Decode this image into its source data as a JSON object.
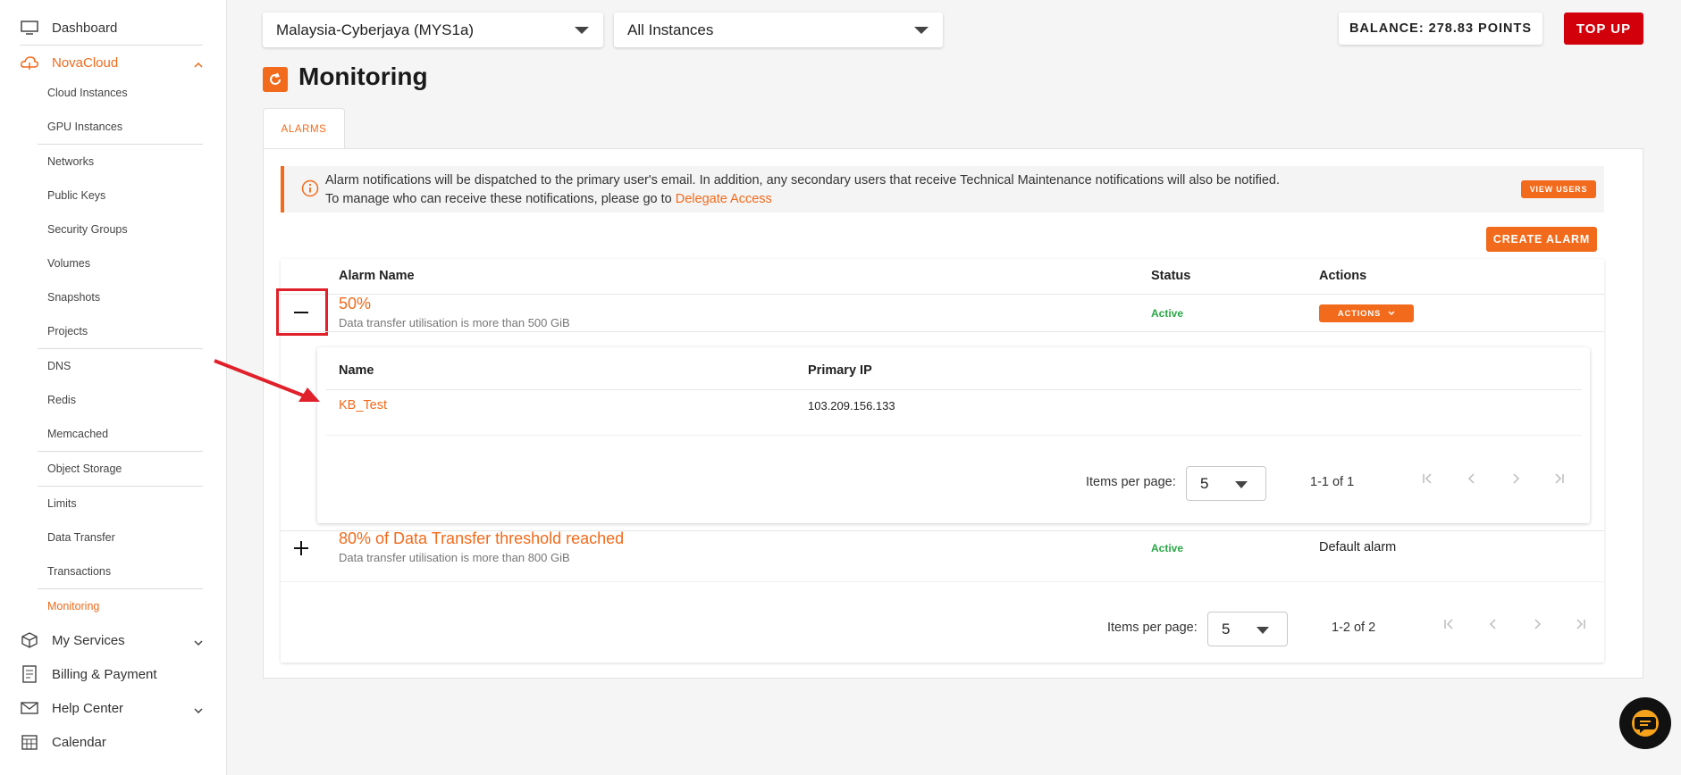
{
  "sidebar": {
    "dashboard": "Dashboard",
    "novacloud": "NovaCloud",
    "sub_items": [
      "Cloud Instances",
      "GPU Instances",
      "Networks",
      "Public Keys",
      "Security Groups",
      "Volumes",
      "Snapshots",
      "Projects",
      "DNS",
      "Redis",
      "Memcached",
      "Object Storage",
      "Limits",
      "Data Transfer",
      "Transactions",
      "Monitoring"
    ],
    "active_item": "Monitoring",
    "my_services": "My Services",
    "billing": "Billing & Payment",
    "help_center": "Help Center",
    "calendar": "Calendar"
  },
  "topbar": {
    "region": "Malaysia-Cyberjaya (MYS1a)",
    "instances": "All Instances",
    "balance": "BALANCE: 278.83 POINTS",
    "topup": "TOP UP"
  },
  "page": {
    "title": "Monitoring",
    "tab": "ALARMS"
  },
  "notice": {
    "text": "Alarm notifications will be dispatched to the primary user's email. In addition, any secondary users that receive Technical Maintenance notifications will also be notified. To manage who can receive these notifications, please go to ",
    "link": "Delegate Access",
    "view_users": "VIEW USERS"
  },
  "create_alarm": "CREATE ALARM",
  "alarms_table": {
    "headers": {
      "name": "Alarm Name",
      "status": "Status",
      "actions": "Actions"
    },
    "rows": [
      {
        "name": "50%",
        "description": "Data transfer utilisation is more than 500 GiB",
        "status": "Active",
        "action": "ACTIONS",
        "expanded": true,
        "toggle": "–"
      },
      {
        "name": "80% of Data Transfer threshold reached",
        "description": "Data transfer utilisation is more than 800 GiB",
        "status": "Active",
        "action": "Default alarm",
        "expanded": false,
        "toggle": "+"
      }
    ]
  },
  "instances_table": {
    "headers": {
      "name": "Name",
      "ip": "Primary IP"
    },
    "rows": [
      {
        "name": "KB_Test",
        "ip": "103.209.156.133"
      }
    ],
    "pagination": {
      "label": "Items per page:",
      "per_page": "5",
      "range": "1-1 of 1"
    }
  },
  "main_pagination": {
    "label": "Items per page:",
    "per_page": "5",
    "range": "1-2 of 2"
  },
  "colors": {
    "accent": "#f26a1b",
    "brand_red": "#d1000b",
    "status_active": "#28a745",
    "annotation": "#e0202a"
  },
  "icons": [
    "monitor-icon",
    "cloud-icon",
    "chevron-up-icon",
    "chevron-down-icon",
    "box-icon",
    "billing-icon",
    "mail-icon",
    "calendar-icon",
    "refresh-icon",
    "info-icon",
    "chat-icon"
  ]
}
